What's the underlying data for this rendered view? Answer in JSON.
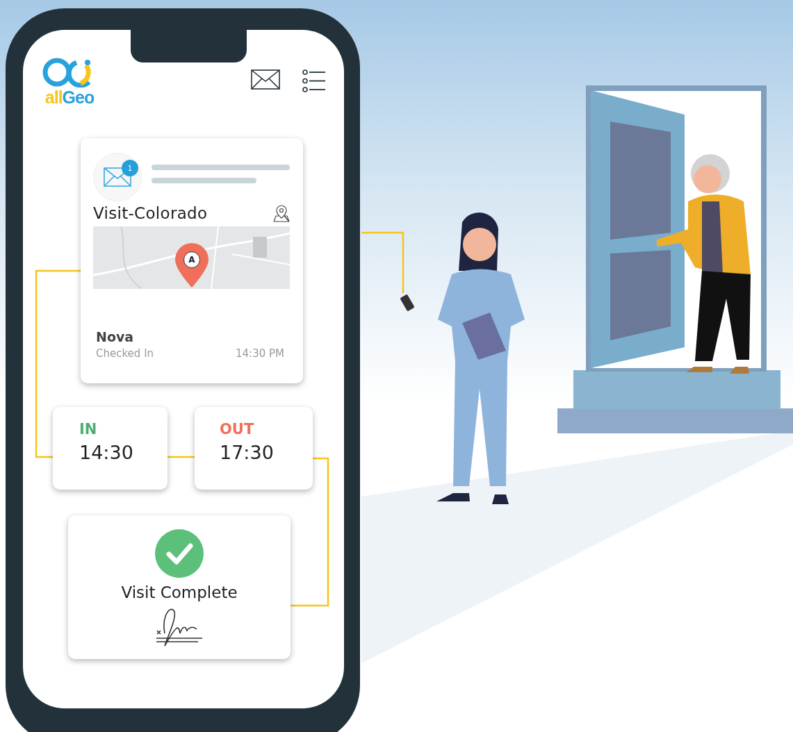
{
  "header": {
    "logo": {
      "prefix": "all",
      "suffix": "Geo"
    }
  },
  "visit_card": {
    "badge": "1",
    "title": "Visit-Colorado",
    "map": {
      "marker_label": "A"
    },
    "name": "Nova",
    "status": "Checked In",
    "time": "14:30 PM"
  },
  "times": [
    {
      "label": "IN",
      "value": "14:30",
      "color": "#4caf72"
    },
    {
      "label": "OUT",
      "value": "17:30",
      "color": "#ef6f5a"
    }
  ],
  "completion": {
    "label": "Visit Complete"
  }
}
